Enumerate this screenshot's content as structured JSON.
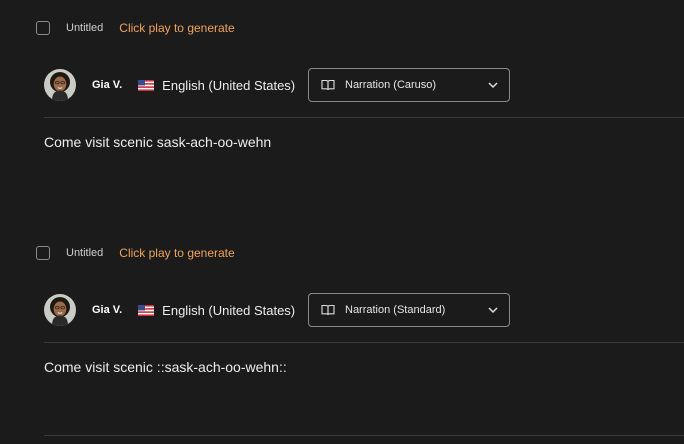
{
  "items": [
    {
      "title": "Untitled",
      "status": "Click play to generate",
      "speaker": "Gia V.",
      "language": "English (United States)",
      "style": "Narration (Caruso)",
      "text": "Come visit scenic sask-ach-oo-wehn"
    },
    {
      "title": "Untitled",
      "status": "Click play to generate",
      "speaker": "Gia V.",
      "language": "English (United States)",
      "style": "Narration (Standard)",
      "text": "Come visit scenic ::sask-ach-oo-wehn::"
    }
  ],
  "colors": {
    "background": "#1b1b1b",
    "accent": "#f0a35c",
    "divider": "#3a3a3a"
  },
  "icons": {
    "checkbox": "checkbox-icon",
    "flag": "us-flag-icon",
    "style": "book-icon",
    "dropdown": "chevron-down-icon"
  }
}
